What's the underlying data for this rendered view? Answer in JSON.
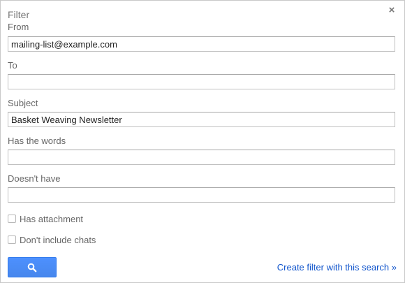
{
  "dialog": {
    "title": "Filter",
    "close_glyph": "×"
  },
  "fields": {
    "from": {
      "label": "From",
      "value": "mailing-list@example.com"
    },
    "to": {
      "label": "To",
      "value": ""
    },
    "subject": {
      "label": "Subject",
      "value": "Basket Weaving Newsletter"
    },
    "has_words": {
      "label": "Has the words",
      "value": ""
    },
    "doesnt_have": {
      "label": "Doesn't have",
      "value": ""
    }
  },
  "options": {
    "has_attachment": {
      "label": "Has attachment",
      "checked": false
    },
    "dont_include_chats": {
      "label": "Don't include chats",
      "checked": false
    }
  },
  "actions": {
    "search_icon": "search-icon",
    "create_filter_label": "Create filter with this search »"
  },
  "colors": {
    "accent": "#4d90fe",
    "link": "#1155cc"
  }
}
